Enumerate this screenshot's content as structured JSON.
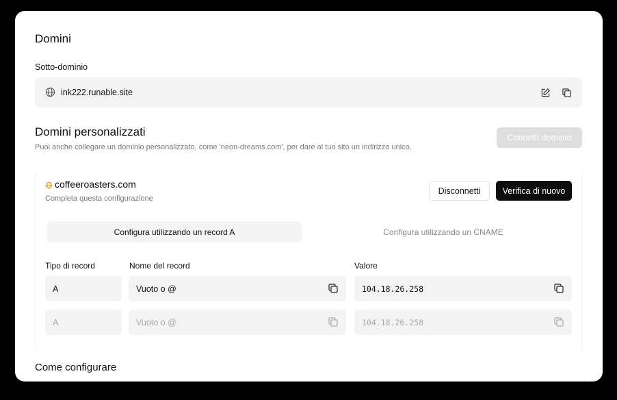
{
  "domains": {
    "title": "Domini",
    "subdomain_label": "Sotto-dominio",
    "subdomain_value": "ink222.runable.site",
    "icons": [
      "globe-icon",
      "edit-icon",
      "copy-icon"
    ]
  },
  "custom_domains": {
    "title": "Domini personalizzati",
    "description": "Puoi anche collegare un dominio personalizzato, come 'neon-dreams.com', per dare al tuo sito un indirizzo unico.",
    "connect_button": "Connetti dominio"
  },
  "domain_card": {
    "domain": "coffeeroasters.com",
    "status": "Completa questa configurazione",
    "disconnect_button": "Disconnetti",
    "verify_button": "Verifica di nuovo",
    "tabs": [
      {
        "label": "Configura utilizzando un record A",
        "active": true
      },
      {
        "label": "Configura utilizzando un CNAME",
        "active": false
      }
    ],
    "columns": [
      "Tipo di record",
      "Nome del record",
      "Valore"
    ],
    "rows": [
      {
        "type": "A",
        "name": "Vuoto o @",
        "value": "104.18.26.258"
      },
      {
        "type": "A",
        "name": "Vuoto o @",
        "value": "104.18.26.258"
      }
    ]
  },
  "how_to": {
    "title": "Come configurare"
  },
  "colors": {
    "accent_dark": "#0d0d0d",
    "field_bg": "#f3f3f3",
    "globe_warning": "#e0a43a"
  }
}
